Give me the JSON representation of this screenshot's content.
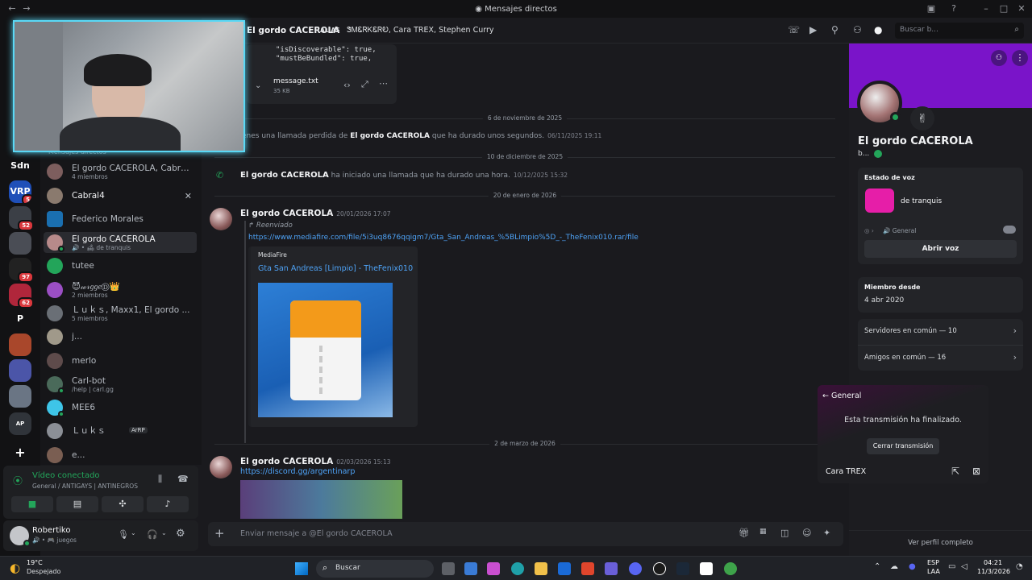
{
  "window": {
    "title": "Mensajes directos"
  },
  "header": {
    "name": "El gordo CACEROLA",
    "alias_label": "ALIAS",
    "alias_values": "ᏕᎷᏋᏒᏦᏋᏒᎧ, Cara TREX, Stephen Curry",
    "search_placeholder": "Buscar b..."
  },
  "servers": [
    {
      "label": "Sdn",
      "badge": ""
    },
    {
      "label": "VRP",
      "badge": "5"
    },
    {
      "label": "",
      "badge": "52"
    },
    {
      "label": "",
      "badge": ""
    },
    {
      "label": "",
      "badge": "97"
    },
    {
      "label": "",
      "badge": "62"
    },
    {
      "label": "P",
      "badge": ""
    },
    {
      "label": "",
      "badge": ""
    },
    {
      "label": "",
      "badge": ""
    },
    {
      "label": "",
      "badge": ""
    },
    {
      "label": "AP",
      "badge": ""
    },
    {
      "label": "+",
      "badge": ""
    }
  ],
  "dm_section_label": "Mensajes directos",
  "dms": [
    {
      "name": "El gordo CACEROLA, Cabral4, l...",
      "sub": "4 miembros"
    },
    {
      "name": "Cabral4",
      "sub": ""
    },
    {
      "name": "Federico Morales",
      "sub": ""
    },
    {
      "name": "El gordo CACEROLA",
      "sub": "🔊 • 🛋 de tranquis"
    },
    {
      "name": "tutee",
      "sub": ""
    },
    {
      "name": "😈𝓌𝓇𝑔𝑔𝑒Ⓓ👑",
      "sub": "2 miembros"
    },
    {
      "name": "Ｌｕｋｓ, Maxx1, El gordo ...",
      "sub": "5 miembros"
    },
    {
      "name": "j...",
      "sub": ""
    },
    {
      "name": "merlo",
      "sub": ""
    },
    {
      "name": "Carl-bot",
      "sub": "/help | carl.gg"
    },
    {
      "name": "MEE6",
      "sub": ""
    },
    {
      "name": "Ｌｕｋｓ",
      "sub": ""
    },
    {
      "name": "e...",
      "sub": ""
    }
  ],
  "dm_tag": "ArRP",
  "voice": {
    "title": "Vídeo conectado",
    "channel": "General / ANTIGAYS | ANTINEGROS"
  },
  "user": {
    "name": "Robertiko",
    "status": "🔊 • 🎮 juegos"
  },
  "file_attachment": {
    "code_line1": "\"isDiscoverable\": true,",
    "code_line2": "\"mustBeBundled\": true,",
    "name": "message.txt",
    "size": "35 KB"
  },
  "dividers": [
    "6 de noviembre de 2025",
    "10 de diciembre de 2025",
    "20 de enero de 2026",
    "2 de marzo de 2026"
  ],
  "system_messages": {
    "missed_prefix": "enes una llamada perdida de ",
    "missed_name": "El gordo CACEROLA",
    "missed_suffix": " que ha durado unos segundos.",
    "missed_ts": "06/11/2025 19:11",
    "call_name": "El gordo CACEROLA",
    "call_text": " ha iniciado una llamada que ha durado una hora.",
    "call_ts": "10/12/2025 15:32"
  },
  "messages": [
    {
      "author": "El gordo CACEROLA",
      "timestamp": "20/01/2026 17:07",
      "forwarded_label": "Reenviado",
      "link": "https://www.mediafire.com/file/5i3uq8676qqigm7/Gta_San_Andreas_%5BLimpio%5D_-_TheFenix010.rar/file",
      "embed_site": "MediaFire",
      "embed_title": "Gta San Andreas [Limpio] - TheFenix010"
    },
    {
      "author": "El gordo CACEROLA",
      "timestamp": "02/03/2026 15:13",
      "link": "https://discord.gg/argentinarp"
    }
  ],
  "composer": {
    "placeholder": "Enviar mensaje a @El gordo CACEROLA"
  },
  "profile": {
    "name": "El gordo CACEROLA",
    "tag": "b...",
    "voice_label": "Estado de voz",
    "voice_activity": "de tranquis",
    "voice_channel": "🔊 General",
    "open_voice": "Abrir voz",
    "member_since_label": "Miembro desde",
    "member_since": "4 abr 2020",
    "servers_common": "Servidores en común — 10",
    "friends_common": "Amigos en común — 16",
    "view_profile": "Ver perfil completo"
  },
  "stream": {
    "back_label": "← General",
    "ended_text": "Esta transmisión ha finalizado.",
    "close_button": "Cerrar transmisión",
    "streamer": "Cara TREX"
  },
  "taskbar": {
    "weather_temp": "19°C",
    "weather_desc": "Despejado",
    "search": "Buscar",
    "lang1": "ESP",
    "lang2": "LAA",
    "time": "04:21",
    "date": "11/3/2026"
  },
  "colors": {
    "accent": "#5865f2",
    "online": "#23a55a",
    "banner": "#7a14c9",
    "link": "#4ea2f5",
    "webcam_border": "#5ad8f5"
  }
}
